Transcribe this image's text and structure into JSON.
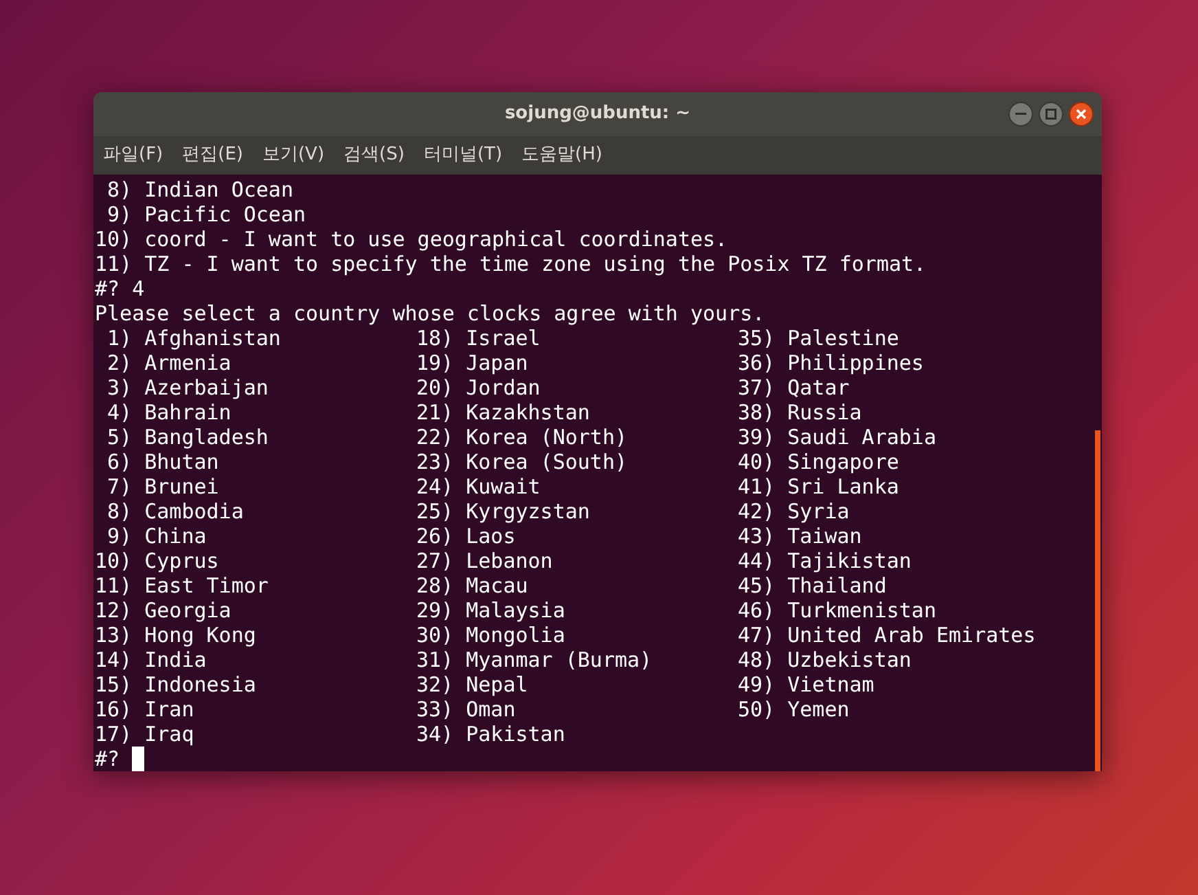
{
  "window": {
    "title": "sojung@ubuntu: ~"
  },
  "menu": [
    "파일(F)",
    "편집(E)",
    "보기(V)",
    "검색(S)",
    "터미널(T)",
    "도움말(H)"
  ],
  "terminal": {
    "lines_before": [
      " 8) Indian Ocean",
      " 9) Pacific Ocean",
      "10) coord - I want to use geographical coordinates.",
      "11) TZ - I want to specify the time zone using the Posix TZ format.",
      "#? 4",
      "Please select a country whose clocks agree with yours."
    ],
    "countries": [
      " 1) Afghanistan",
      " 2) Armenia",
      " 3) Azerbaijan",
      " 4) Bahrain",
      " 5) Bangladesh",
      " 6) Bhutan",
      " 7) Brunei",
      " 8) Cambodia",
      " 9) China",
      "10) Cyprus",
      "11) East Timor",
      "12) Georgia",
      "13) Hong Kong",
      "14) India",
      "15) Indonesia",
      "16) Iran",
      "17) Iraq",
      "18) Israel",
      "19) Japan",
      "20) Jordan",
      "21) Kazakhstan",
      "22) Korea (North)",
      "23) Korea (South)",
      "24) Kuwait",
      "25) Kyrgyzstan",
      "26) Laos",
      "27) Lebanon",
      "28) Macau",
      "29) Malaysia",
      "30) Mongolia",
      "31) Myanmar (Burma)",
      "32) Nepal",
      "33) Oman",
      "34) Pakistan",
      "35) Palestine",
      "36) Philippines",
      "37) Qatar",
      "38) Russia",
      "39) Saudi Arabia",
      "40) Singapore",
      "41) Sri Lanka",
      "42) Syria",
      "43) Taiwan",
      "44) Tajikistan",
      "45) Thailand",
      "46) Turkmenistan",
      "47) United Arab Emirates",
      "48) Uzbekistan",
      "49) Vietnam",
      "50) Yemen"
    ],
    "prompt": "#?"
  }
}
